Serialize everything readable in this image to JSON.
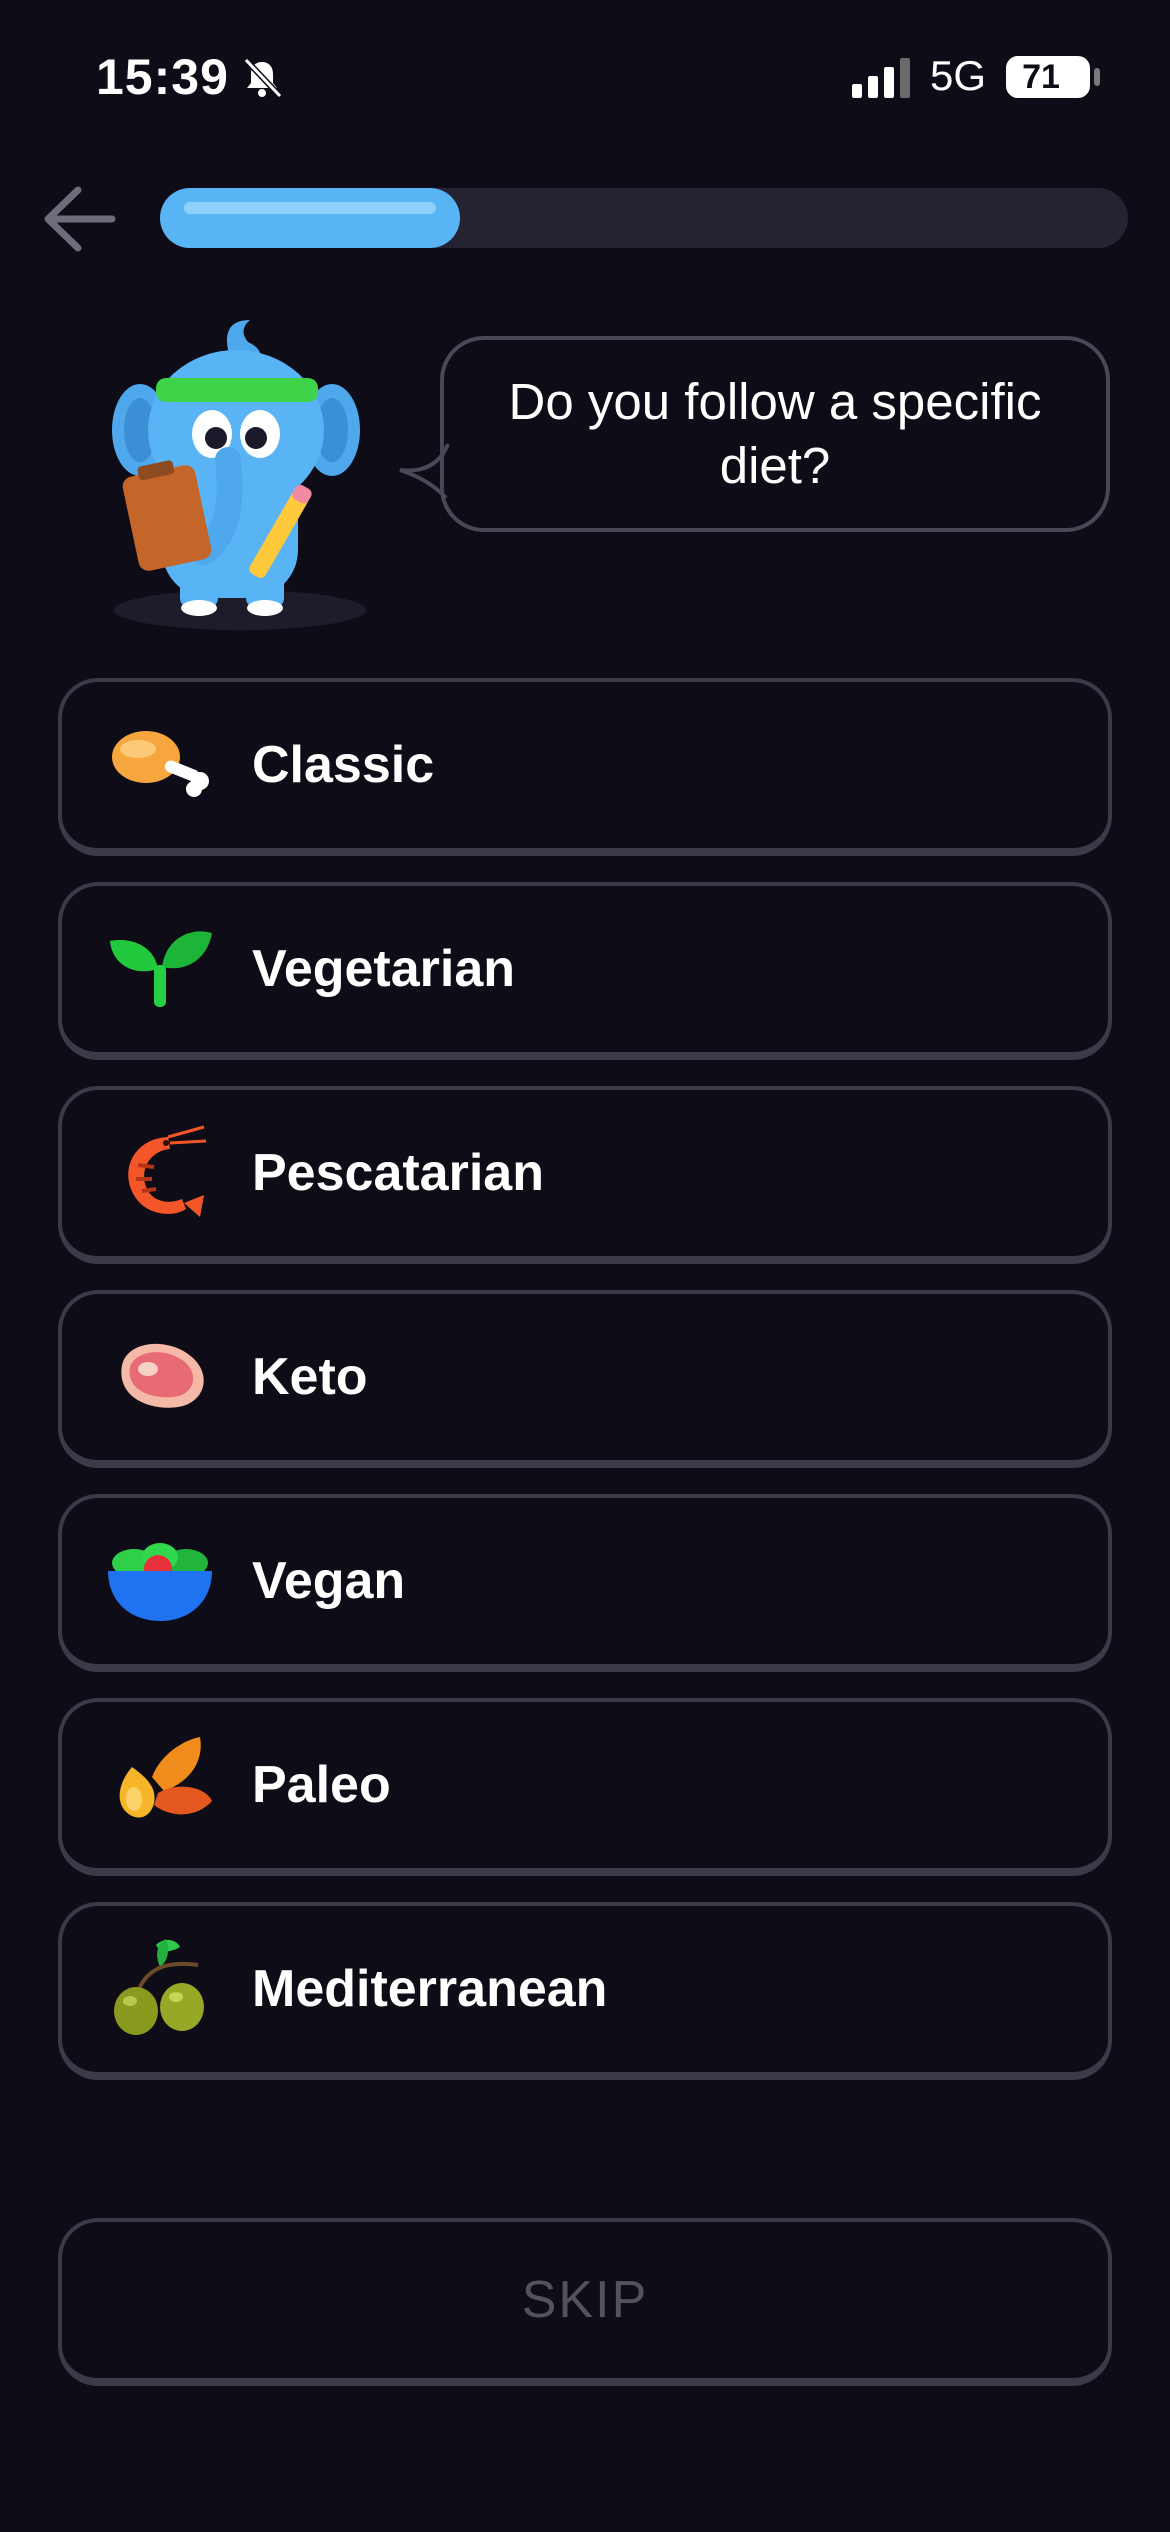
{
  "status_bar": {
    "time": "15:39",
    "network": "5G",
    "battery": "71"
  },
  "progress": {
    "value": 0.31
  },
  "question": "Do you follow a specific diet?",
  "options": [
    {
      "label": "Classic",
      "icon": "chicken-leg-icon"
    },
    {
      "label": "Vegetarian",
      "icon": "sprout-icon"
    },
    {
      "label": "Pescatarian",
      "icon": "shrimp-icon"
    },
    {
      "label": "Keto",
      "icon": "steak-icon"
    },
    {
      "label": "Vegan",
      "icon": "salad-bowl-icon"
    },
    {
      "label": "Paleo",
      "icon": "nuts-icon"
    },
    {
      "label": "Mediterranean",
      "icon": "olives-icon"
    }
  ],
  "skip_label": "SKIP",
  "colors": {
    "background": "#0e0c17",
    "accent": "#58b4f5",
    "border": "#3c3a48",
    "skip_text": "#55525f"
  }
}
